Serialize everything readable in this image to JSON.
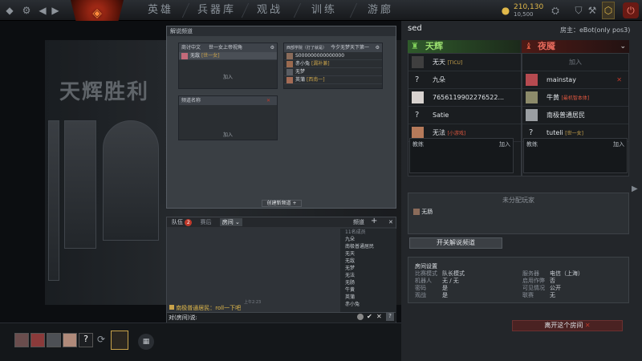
{
  "topbar": {
    "nav": [
      "英雄",
      "兵器库",
      "观战",
      "训练",
      "游廊"
    ],
    "gold": "210,130",
    "gold_sub": "10,500"
  },
  "backdrop": {
    "banner_title": "天辉胜利"
  },
  "modal": {
    "title": "解说频道",
    "channels": [
      {
        "tag": "商讨中文",
        "name": "世一女上帝视角",
        "members": [
          {
            "name": "无敌",
            "tag": "[世一女]"
          }
        ],
        "join": "加入"
      },
      {
        "tag": "西部学院（打了就是）",
        "name": "今夕无梦天下第一",
        "members": [
          {
            "name": "S000000000000000",
            "tag": ""
          },
          {
            "name": "赤小兔",
            "tag": "[漏补兼]"
          },
          {
            "name": "无梦",
            "tag": ""
          },
          {
            "name": "英蒲",
            "tag": "[西南一]"
          }
        ],
        "join": ""
      },
      {
        "tag": "",
        "name": "频道名称",
        "members": [],
        "join": "加入"
      }
    ],
    "create_button": "创建新频道 +"
  },
  "chat": {
    "tabs": [
      {
        "label": "队伍",
        "badge": "2"
      },
      {
        "label": "赛后",
        "badge": ""
      },
      {
        "label": "房间",
        "badge": ""
      }
    ],
    "channels_label": "频道",
    "time": "上午2:23",
    "last_message_user": "南极普通居民",
    "last_message_text": "：roll一下吧",
    "input_placeholder": "对(房间)说:",
    "channel_list_header": "11名成员",
    "members": [
      "九朵",
      "南极普通居民",
      "无天",
      "无敌",
      "无梦",
      "无法",
      "无肠",
      "牛黄",
      "英蒲",
      "赤小兔"
    ]
  },
  "lobby": {
    "name": "sed",
    "host": "房主：eBot(only pos3)",
    "radiant": "天辉",
    "dire": "夜魇",
    "radiant_players": [
      {
        "name": "无天",
        "tag": "[TICU]",
        "avatar": true
      },
      {
        "name": "九朵",
        "tag": "",
        "avatar": false
      },
      {
        "name": "7656119902276522...",
        "tag": "",
        "avatar": true
      },
      {
        "name": "Satie",
        "tag": "",
        "avatar": false
      },
      {
        "name": "无法",
        "tag": "[小游戏]",
        "avatar": true
      }
    ],
    "dire_players": [
      {
        "name": "",
        "tag": "",
        "join": "加入",
        "avatar": false
      },
      {
        "name": "mainstay",
        "tag": "",
        "avatar": true
      },
      {
        "name": "牛黄",
        "tag": "[最机智本体]",
        "avatar": true
      },
      {
        "name": "南极普通居民",
        "tag": "",
        "avatar": true
      },
      {
        "name": "tuteli",
        "tag": "[世一女]",
        "avatar": false
      }
    ],
    "coach_label": "教练",
    "join": "加入",
    "unassigned_label": "未分配玩家",
    "unassigned": [
      "无肠"
    ],
    "toggle_caster": "开关解说频道",
    "settings": {
      "title": "房间设置",
      "rows": [
        {
          "k": "比赛模式",
          "v": "队长模式"
        },
        {
          "k": "机器人",
          "v": "无 / 无"
        },
        {
          "k": "密码",
          "v": "是"
        },
        {
          "k": "观战",
          "v": "是"
        }
      ],
      "rows2": [
        {
          "k": "服务器",
          "v": "电信（上海）"
        },
        {
          "k": "启用作弊",
          "v": "否"
        },
        {
          "k": "可见情况",
          "v": "公开"
        },
        {
          "k": "联赛",
          "v": "无"
        }
      ]
    },
    "leave": "离开这个房间"
  },
  "colors": {
    "radiant": "#5cb85c",
    "dire": "#c0392b",
    "accent": "#e0b84a"
  }
}
